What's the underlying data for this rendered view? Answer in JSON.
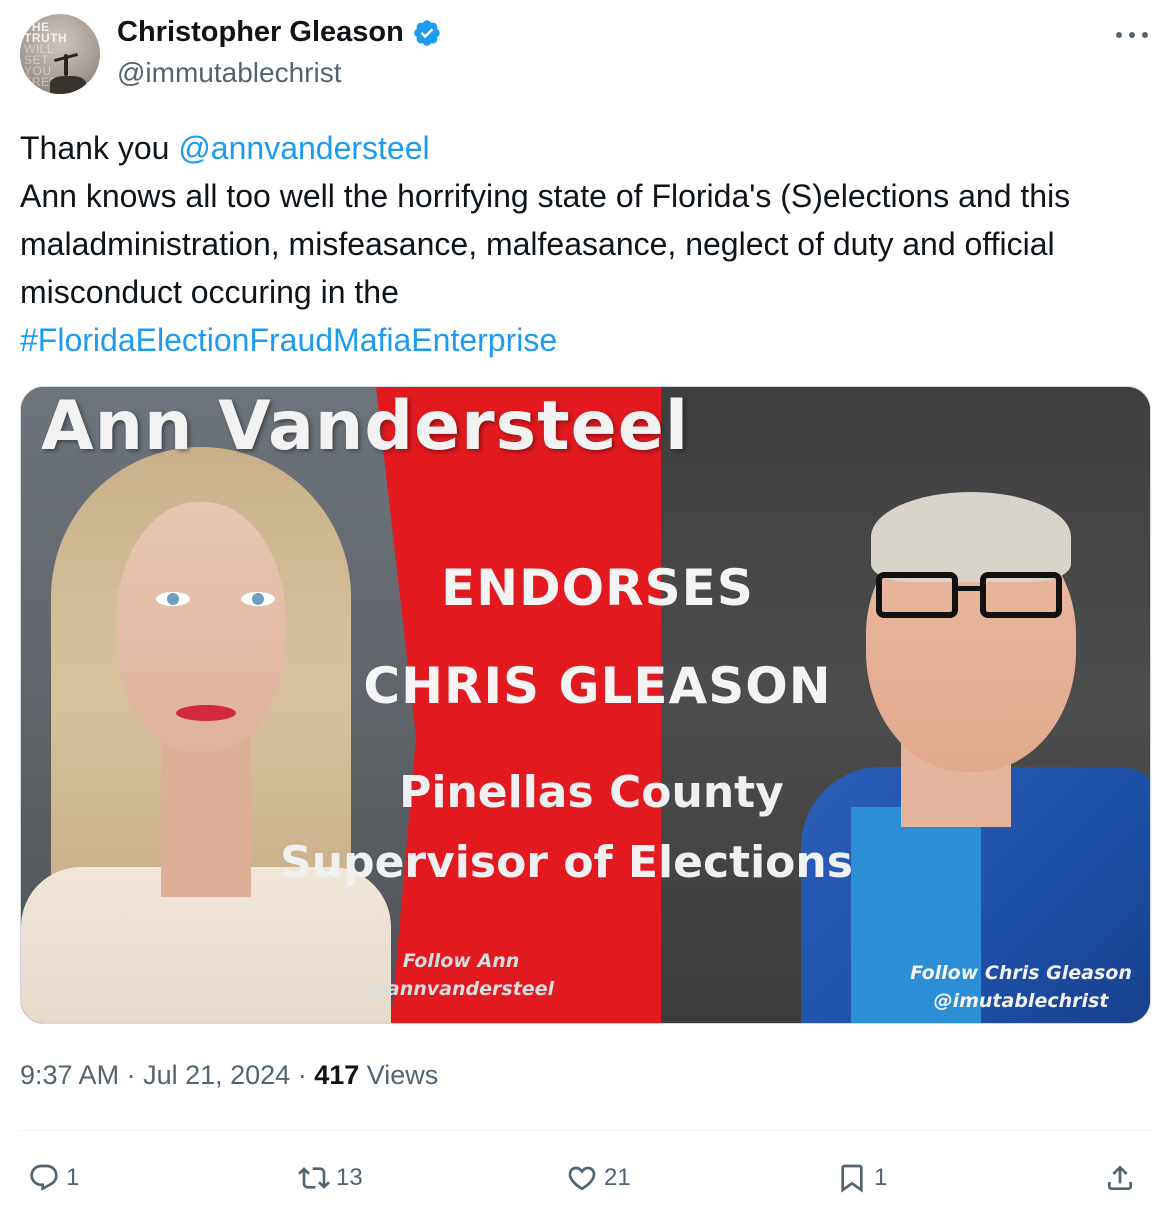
{
  "author": {
    "display_name": "Christopher Gleason",
    "handle": "@immutablechrist",
    "verified": true,
    "avatar_text": [
      "THE",
      "TRUTH",
      "WILL",
      "SET",
      "YOU",
      "FREE"
    ]
  },
  "tweet": {
    "text_prefix": "Thank you ",
    "mention": "@annvandersteel",
    "text_body": "Ann knows all too well the horrifying state of Florida's (S)elections and this maladministration, misfeasance, malfeasance, neglect of duty and official misconduct occuring in the",
    "hashtag": "#FloridaElectionFraudMafiaEnterprise"
  },
  "media": {
    "title": "Ann Vandersteel",
    "line1": "ENDORSES",
    "line2": "CHRIS GLEASON",
    "line3": "Pinellas  County",
    "line4": "Supervisor of Elections",
    "follow_left_1": "Follow Ann",
    "follow_left_2": "@annvandersteel",
    "follow_right_1": "Follow Chris Gleason",
    "follow_right_2": "@imutablechrist"
  },
  "meta": {
    "time": "9:37 AM",
    "separator": " · ",
    "date": "Jul 21, 2024",
    "views_count": "417",
    "views_label": " Views"
  },
  "actions": {
    "replies": "1",
    "reposts": "13",
    "likes": "21",
    "bookmarks": "1"
  },
  "colors": {
    "link": "#1d9bf0",
    "secondary_text": "#536471",
    "verified": "#1d9bf0",
    "poster_red": "#e21a1f"
  }
}
